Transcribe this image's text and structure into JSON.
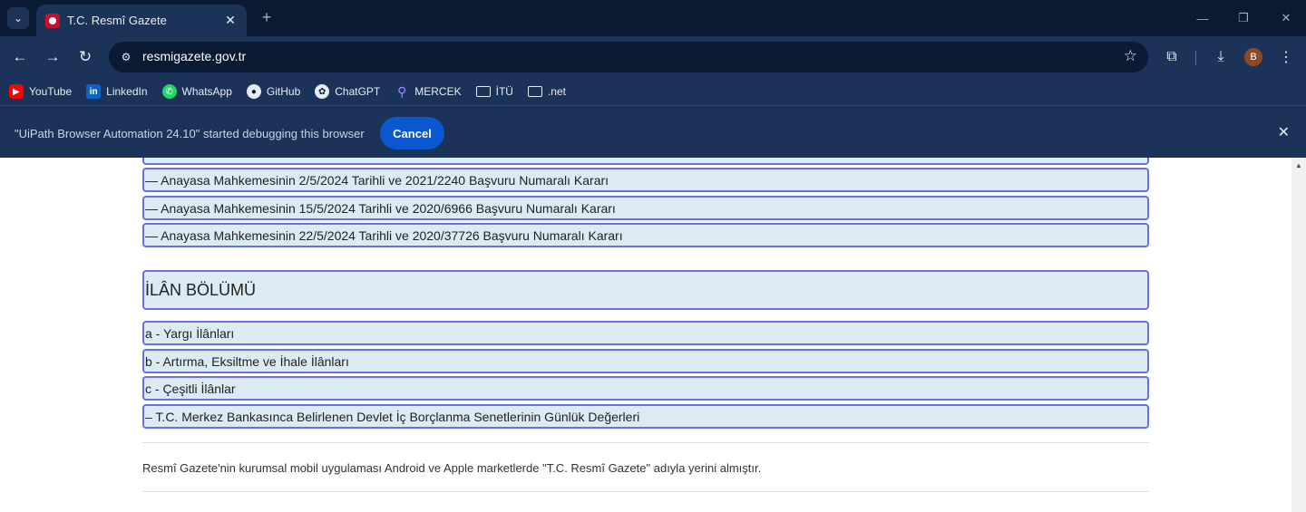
{
  "browser": {
    "tab_title": "T.C. Resmî Gazete",
    "url": "resmigazete.gov.tr",
    "avatar_letter": "B",
    "bookmarks": [
      "YouTube",
      "LinkedIn",
      "WhatsApp",
      "GitHub",
      "ChatGPT",
      "MERCEK",
      "İTÜ",
      ".net"
    ],
    "debug_message": "\"UiPath Browser Automation 24.10\" started debugging this browser",
    "cancel_label": "Cancel"
  },
  "page": {
    "rulings": [
      "— Anayasa Mahkemesinin 2/5/2024 Tarihli ve 2021/2240 Başvuru Numaralı Kararı",
      "— Anayasa Mahkemesinin 15/5/2024 Tarihli ve 2020/6966 Başvuru Numaralı Kararı",
      "— Anayasa Mahkemesinin 22/5/2024 Tarihli ve 2020/37726 Başvuru Numaralı Kararı"
    ],
    "section_title": "İLÂN BÖLÜMÜ",
    "announcements": [
      "a - Yargı İlânları",
      "b - Artırma, Eksiltme ve İhale İlânları",
      "c - Çeşitli İlânlar",
      "– T.C. Merkez Bankasınca Belirlenen Devlet İç Borçlanma Senetlerinin Günlük Değerleri"
    ],
    "footer": "Resmî Gazete'nin kurumsal mobil uygulaması Android ve Apple marketlerde \"T.C. Resmî Gazete\" adıyla yerini almıştır."
  }
}
